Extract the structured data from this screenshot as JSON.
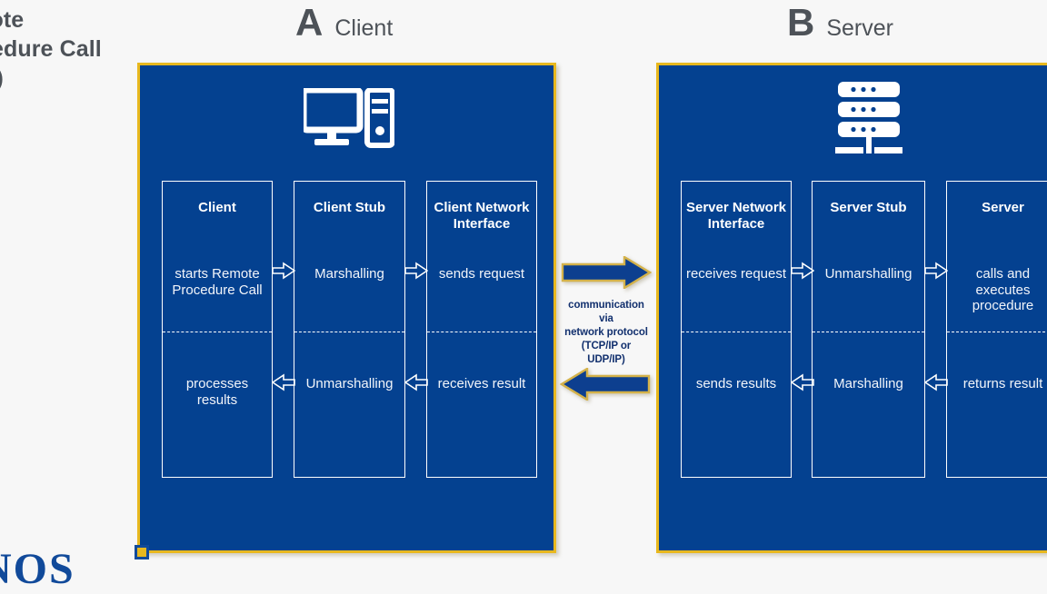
{
  "slide": {
    "title": "Remote Procedure Call (RPC)",
    "background_color": "#f7f7f7",
    "panel_color": "#044190",
    "panel_border_color": "#e8b81e",
    "text_color": "#4d5258"
  },
  "sections": {
    "client": {
      "letter": "A",
      "label": "Client",
      "icon": "desktop-computer-icon"
    },
    "server": {
      "letter": "B",
      "label": "Server",
      "icon": "server-rack-icon"
    }
  },
  "client_panel": {
    "columns": [
      {
        "title": "Client",
        "upper": "starts Remote Procedure Call",
        "lower": "processes results"
      },
      {
        "title": "Client Stub",
        "upper": "Marshalling",
        "lower": "Unmarshalling"
      },
      {
        "title": "Client Network Interface",
        "upper": "sends request",
        "lower": "receives result"
      }
    ]
  },
  "server_panel": {
    "columns": [
      {
        "title": "Server Network Interface",
        "upper": "receives request",
        "lower": "sends results"
      },
      {
        "title": "Server Stub",
        "upper": "Unmarshalling",
        "lower": "Marshalling"
      },
      {
        "title": "Server",
        "upper": "calls and executes procedure",
        "lower": "returns result"
      }
    ]
  },
  "communication": {
    "line1": "communication",
    "line2": "via",
    "line3": "network protocol",
    "line4": "(TCP/IP or",
    "line5": "UDP/IP)",
    "arrow_right": "request-arrow-right",
    "arrow_left": "response-arrow-left",
    "arrow_fill": "#0d3f8f",
    "arrow_outline": "#d4b24a"
  },
  "logo": {
    "text": "NOS"
  }
}
